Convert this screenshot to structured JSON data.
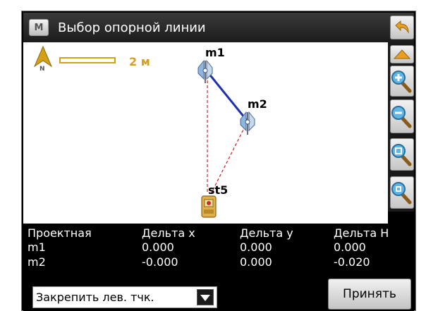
{
  "window": {
    "title": "Выбор опорной линии",
    "menu_icon_text": "M"
  },
  "map": {
    "scale_label": "2 м",
    "north_label": "N",
    "points": [
      {
        "name": "m1",
        "icon": "prism-pole-icon"
      },
      {
        "name": "m2",
        "icon": "prism-pole-icon"
      },
      {
        "name": "st5",
        "icon": "total-station-icon"
      }
    ],
    "colors": {
      "baseline": "#1f2fb0",
      "helper_line": "#cc2020",
      "scale": "#d4a017"
    }
  },
  "toolbar": {
    "buttons": [
      "back-icon",
      "pan-up-icon",
      "zoom-in-icon",
      "zoom-out-icon",
      "zoom-window-icon",
      "zoom-extents-icon"
    ]
  },
  "table": {
    "headers": [
      "Проектная",
      "Дельта x",
      "Дельта y",
      "Дельта H"
    ],
    "rows": [
      [
        "m1",
        "0.000",
        "0.000",
        "0.000"
      ],
      [
        "m2",
        "-0.000",
        "0.000",
        "-0.020"
      ]
    ]
  },
  "bottom": {
    "combo_value": "Закрепить лев. тчк.",
    "accept_label": "Принять"
  }
}
